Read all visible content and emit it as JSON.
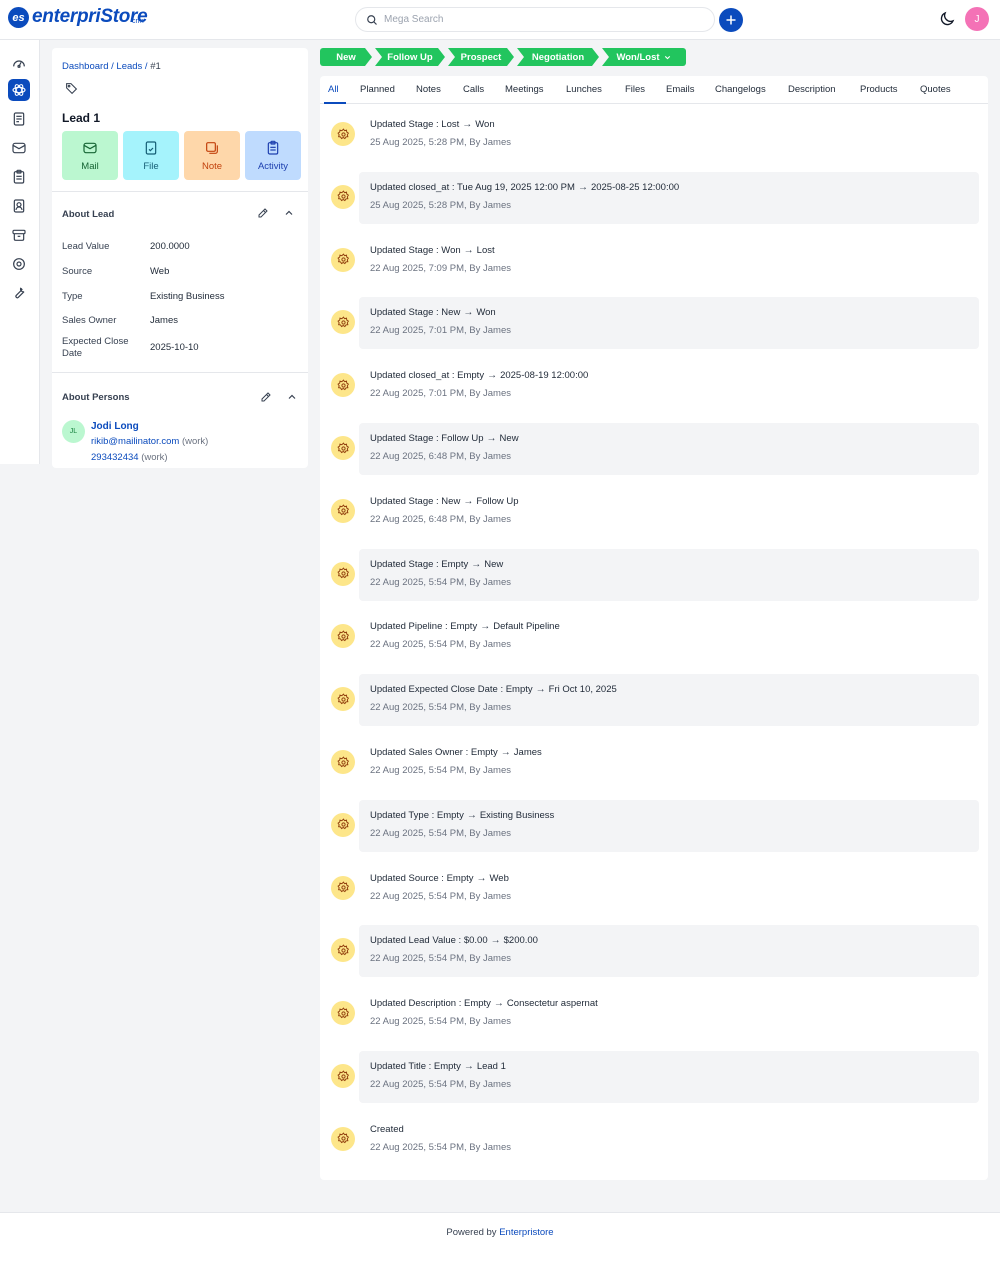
{
  "app": {
    "logo_text": "enterpriStore",
    "logo_badge": "es",
    "logo_sub": "crm"
  },
  "header": {
    "search_placeholder": "Mega Search",
    "user_initial": "J"
  },
  "breadcrumb": {
    "dashboard": "Dashboard",
    "leads": "Leads",
    "current": "#1"
  },
  "lead": {
    "title": "Lead 1"
  },
  "actions": [
    {
      "label": "Mail",
      "color": "#bbf7d0",
      "fg": "#166534"
    },
    {
      "label": "File",
      "color": "#a5f3fc",
      "fg": "#155e75"
    },
    {
      "label": "Note",
      "color": "#fed7aa",
      "fg": "#c2410c"
    },
    {
      "label": "Activity",
      "color": "#bfdbfe",
      "fg": "#1e40af"
    }
  ],
  "about_lead": {
    "title": "About Lead",
    "fields": [
      {
        "label": "Lead Value",
        "value": "200.0000"
      },
      {
        "label": "Source",
        "value": "Web"
      },
      {
        "label": "Type",
        "value": "Existing Business"
      },
      {
        "label": "Sales Owner",
        "value": "James"
      },
      {
        "label": "Expected Close Date",
        "value": "2025-10-10"
      }
    ]
  },
  "about_persons": {
    "title": "About Persons",
    "person": {
      "initials": "JL",
      "name": "Jodi Long",
      "email": "rikib@mailinator.com",
      "email_type": "(work)",
      "phone": "293432434",
      "phone_type": "(work)"
    }
  },
  "pipeline": [
    "New",
    "Follow Up",
    "Prospect",
    "Negotiation",
    "Won/Lost"
  ],
  "tabs": [
    "All",
    "Planned",
    "Notes",
    "Calls",
    "Meetings",
    "Lunches",
    "Files",
    "Emails",
    "Changelogs",
    "Description",
    "Products",
    "Quotes"
  ],
  "activities": [
    {
      "prefix": "Updated Stage : Lost",
      "to": "Won",
      "meta": "25 Aug 2025, 5:28 PM, By James"
    },
    {
      "prefix": "Updated closed_at : Tue Aug 19, 2025 12:00 PM",
      "to": "2025-08-25 12:00:00",
      "meta": "25 Aug 2025, 5:28 PM, By James"
    },
    {
      "prefix": "Updated Stage : Won",
      "to": "Lost",
      "meta": "22 Aug 2025, 7:09 PM, By James"
    },
    {
      "prefix": "Updated Stage : New",
      "to": "Won",
      "meta": "22 Aug 2025, 7:01 PM, By James"
    },
    {
      "prefix": "Updated closed_at : Empty",
      "to": "2025-08-19 12:00:00",
      "meta": "22 Aug 2025, 7:01 PM, By James"
    },
    {
      "prefix": "Updated Stage : Follow Up",
      "to": "New",
      "meta": "22 Aug 2025, 6:48 PM, By James"
    },
    {
      "prefix": "Updated Stage : New",
      "to": "Follow Up",
      "meta": "22 Aug 2025, 6:48 PM, By James"
    },
    {
      "prefix": "Updated Stage : Empty",
      "to": "New",
      "meta": "22 Aug 2025, 5:54 PM, By James"
    },
    {
      "prefix": "Updated Pipeline : Empty",
      "to": "Default Pipeline",
      "meta": "22 Aug 2025, 5:54 PM, By James"
    },
    {
      "prefix": "Updated Expected Close Date : Empty",
      "to": "Fri Oct 10, 2025",
      "meta": "22 Aug 2025, 5:54 PM, By James"
    },
    {
      "prefix": "Updated Sales Owner : Empty",
      "to": "James",
      "meta": "22 Aug 2025, 5:54 PM, By James"
    },
    {
      "prefix": "Updated Type : Empty",
      "to": "Existing Business",
      "meta": "22 Aug 2025, 5:54 PM, By James"
    },
    {
      "prefix": "Updated Source : Empty",
      "to": "Web",
      "meta": "22 Aug 2025, 5:54 PM, By James"
    },
    {
      "prefix": "Updated Lead Value : $0.00",
      "to": "$200.00",
      "meta": "22 Aug 2025, 5:54 PM, By James"
    },
    {
      "prefix": "Updated Description : Empty",
      "to": "Consectetur aspernat",
      "meta": "22 Aug 2025, 5:54 PM, By James"
    },
    {
      "prefix": "Updated Title : Empty",
      "to": "Lead 1",
      "meta": "22 Aug 2025, 5:54 PM, By James"
    },
    {
      "prefix": "Created",
      "to": "",
      "meta": "22 Aug 2025, 5:54 PM, By James"
    }
  ],
  "footer": {
    "prefix": "Powered by",
    "link": "Enterpristore"
  },
  "colors": {
    "brand": "#0b4bbd",
    "stage": "#22c55e",
    "activity_icon_bg": "#fde68a"
  }
}
